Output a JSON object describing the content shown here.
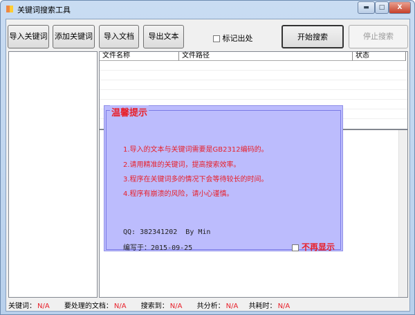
{
  "window": {
    "title": "关键词搜索工具"
  },
  "toolbar": {
    "import_keywords": "导入关键词",
    "add_keyword": "添加关键词",
    "import_docs": "导入文档",
    "export_text": "导出文本",
    "mark_source": "标记出处",
    "start_search": "开始搜索",
    "stop_search": "停止搜索"
  },
  "grid": {
    "columns": [
      "文件名称",
      "文件路径",
      "状态"
    ]
  },
  "status": {
    "keywords_label": "关键词：",
    "keywords_value": "N/A",
    "docs_label": "要处理的文档：",
    "docs_value": "N/A",
    "found_label": "搜索到：",
    "found_value": "N/A",
    "analyzed_label": "共分析：",
    "analyzed_value": "N/A",
    "time_label": "共耗时：",
    "time_value": "N/A"
  },
  "popup": {
    "title": "温馨提示",
    "tips": [
      "1.导入的文本与关键词需要是GB2312编码的。",
      "2.请用精准的关键词，提高搜索效率。",
      "3.程序在关键词多的情况下会等待较长的时间。",
      "4.程序有崩溃的风险，请小心谨慎。"
    ],
    "qq": "QQ: 382341202  By Min",
    "written": "编写于：2015-09-25",
    "dont_show": "不再显示"
  }
}
